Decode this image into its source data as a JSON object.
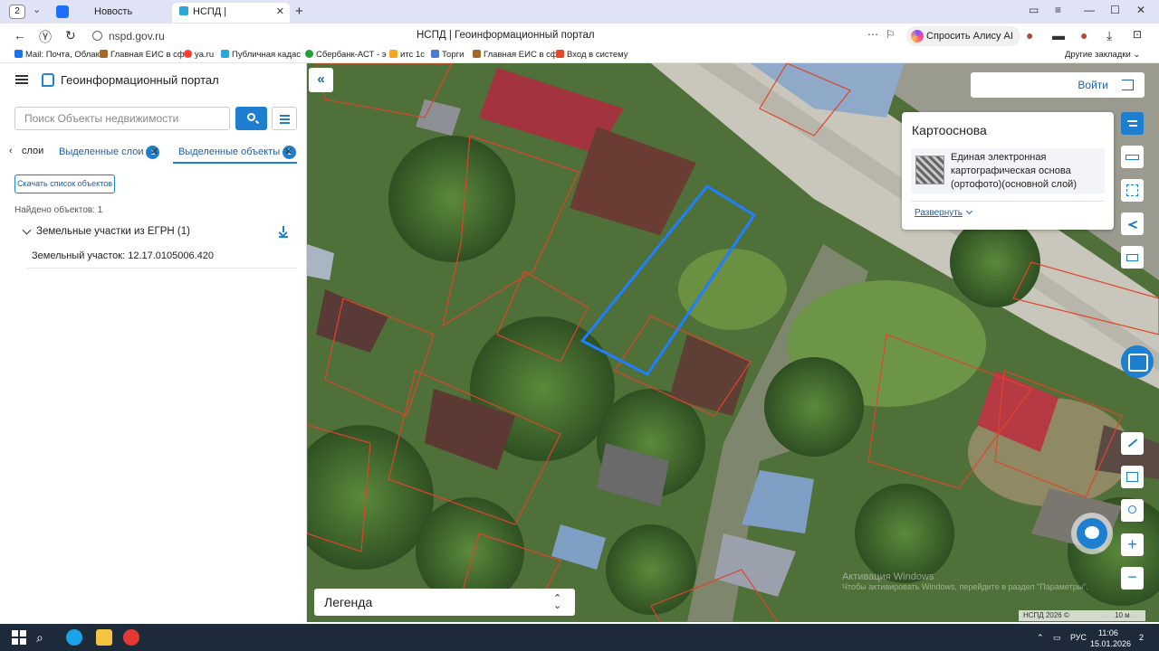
{
  "browser": {
    "tab_count": "2",
    "tabs": [
      {
        "label": "Новость"
      },
      {
        "label": "НСПД | Геоинформаци"
      }
    ],
    "url": "nspd.gov.ru",
    "page_title": "НСПД | Геоинформационный портал",
    "alice_label": "Спросить Алису AI",
    "bookmarks": [
      {
        "label": "Mail: Почта, Облак",
        "color": "#1a73e8"
      },
      {
        "label": "Главная ЕИС в сф",
        "color": "#a06a2a"
      },
      {
        "label": "ya.ru",
        "color": "#ff3b30"
      },
      {
        "label": "Публичная кадас",
        "color": "#2aa7d6"
      },
      {
        "label": "Сбербанк-АСТ - э",
        "color": "#21a038"
      },
      {
        "label": "итс 1с",
        "color": "#f5a623"
      },
      {
        "label": "Торги",
        "color": "#4a7bd0"
      },
      {
        "label": "Главная ЕИС в сф",
        "color": "#a06a2a"
      },
      {
        "label": "Вход в систему",
        "color": "#e04a2a"
      }
    ],
    "other_bookmarks": "Другие закладки"
  },
  "panel": {
    "title": "Геоинформационный портал",
    "search": {
      "placeholder": "Поиск Объекты недвижимости",
      "value": ""
    },
    "tabs": [
      {
        "label": "слои"
      },
      {
        "label": "Выделенные слои",
        "badge": "1"
      },
      {
        "label": "Выделенные объекты",
        "badge": "1"
      }
    ],
    "download_list_label": "Скачать список объектов",
    "found_label": "Найдено объектов: 1",
    "group_label": "Земельные участки из ЕГРН (1)",
    "object_label": "Земельный участок: 12.17.0105006.420"
  },
  "map": {
    "login_label": "Войти",
    "basemap": {
      "title": "Картооснова",
      "layer_name": "Единая электронная картографическая основа (ортофото)(основной слой)",
      "expand_label": "Развернуть"
    },
    "legend_label": "Легенда",
    "activation_title": "Активация Windows",
    "activation_sub": "Чтобы активировать Windows, перейдите в раздел \"Параметры\".",
    "copyright": "НСПД 2026 ©",
    "scale": "10 м",
    "selection_color": "#1e7fff",
    "parcel_border_color": "#e0442a"
  },
  "taskbar": {
    "lang": "РУС",
    "time": "11:06",
    "date": "15.01.2026",
    "notification_count": "2"
  }
}
